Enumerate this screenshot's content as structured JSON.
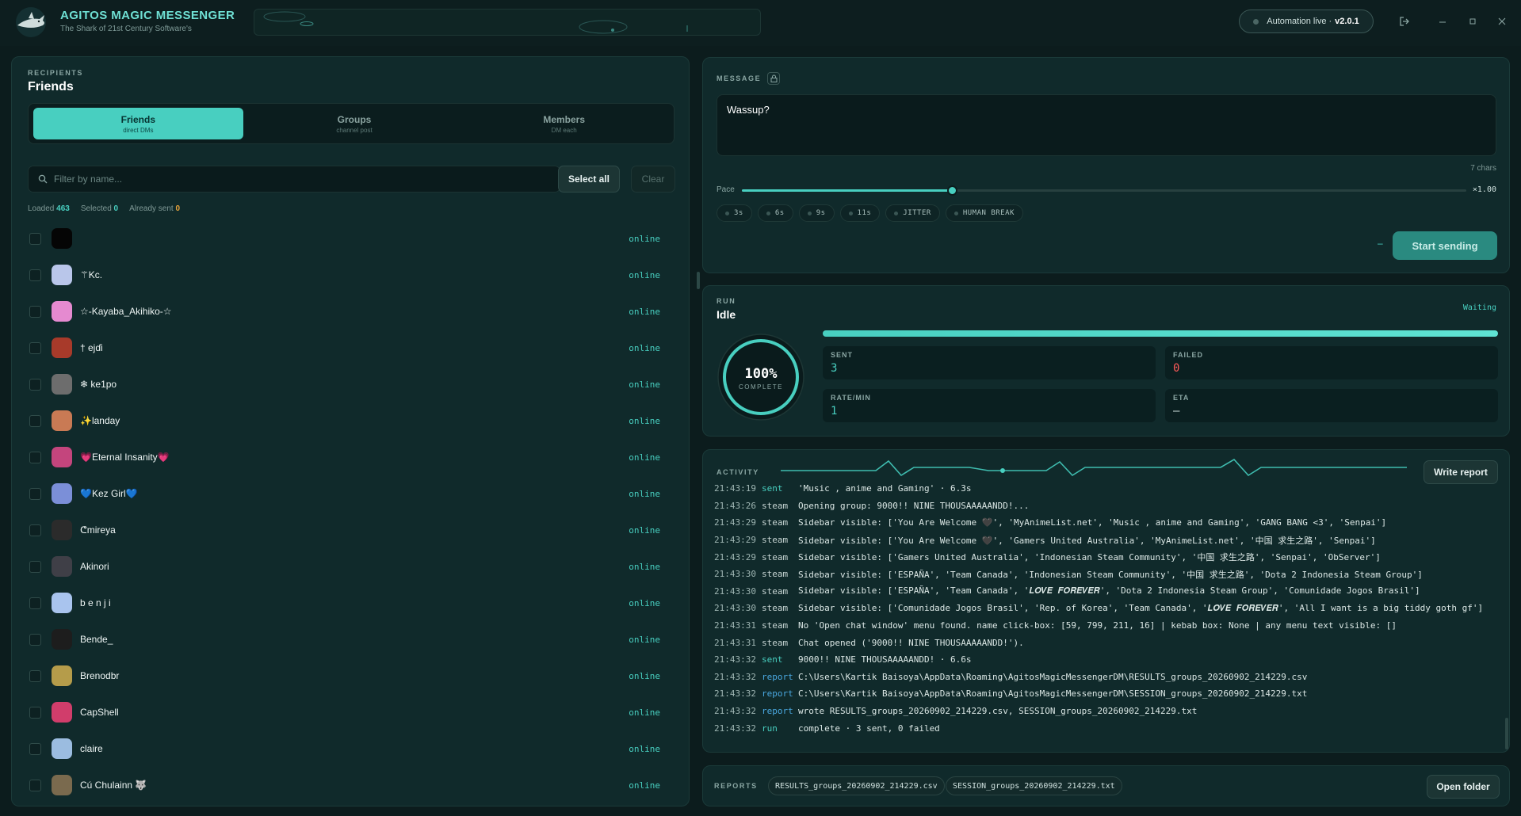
{
  "app": {
    "title": "AGITOS MAGIC MESSENGER",
    "subtitle": "The Shark of 21st Century Software's",
    "automation_label": "Automation live ·",
    "version": "v2.0.1"
  },
  "recipients": {
    "section_label": "RECIPIENTS",
    "title": "Friends",
    "tabs": [
      {
        "label": "Friends",
        "sub": "direct DMs",
        "active": true
      },
      {
        "label": "Groups",
        "sub": "channel post",
        "active": false
      },
      {
        "label": "Members",
        "sub": "DM each",
        "active": false
      }
    ],
    "search_placeholder": "Filter by name...",
    "select_all_label": "Select all",
    "clear_label": "Clear",
    "stats": {
      "loaded_label": "Loaded",
      "loaded": "463",
      "selected_label": "Selected",
      "selected": "0",
      "already_label": "Already sent",
      "already": "0"
    },
    "items": [
      {
        "name": "",
        "status": "online",
        "avatar_color": "#050505"
      },
      {
        "name": "⚚Kc.",
        "status": "online",
        "avatar_color": "#b9c6ea"
      },
      {
        "name": "☆-Kayaba_Akihiko-☆",
        "status": "online",
        "avatar_color": "#e58ad0"
      },
      {
        "name": "† ejɗi",
        "status": "online",
        "avatar_color": "#a83a2a"
      },
      {
        "name": "❄ ke1po",
        "status": "online",
        "avatar_color": "#6d6d6d"
      },
      {
        "name": "✨landay",
        "status": "online",
        "avatar_color": "#c97a54"
      },
      {
        "name": "💗Eternal Insanity💗",
        "status": "online",
        "avatar_color": "#c4457d"
      },
      {
        "name": "💙Kez Girl💙",
        "status": "online",
        "avatar_color": "#7b8fd8"
      },
      {
        "name": "ᕦmireya",
        "status": "online",
        "avatar_color": "#2b2b2b"
      },
      {
        "name": "Akinori",
        "status": "online",
        "avatar_color": "#3f3f47"
      },
      {
        "name": "b e n j i",
        "status": "online",
        "avatar_color": "#a9c4ee"
      },
      {
        "name": "Bende_",
        "status": "online",
        "avatar_color": "#1d1d1d"
      },
      {
        "name": "Brenodbr",
        "status": "online",
        "avatar_color": "#b59c4a"
      },
      {
        "name": "CapShell",
        "status": "online",
        "avatar_color": "#d13d6b"
      },
      {
        "name": "claire",
        "status": "online",
        "avatar_color": "#9bbce0"
      },
      {
        "name": "Cú Chulainn 🐺",
        "status": "online",
        "avatar_color": "#7a6a4e"
      }
    ]
  },
  "message": {
    "section_label": "MESSAGE",
    "text": "Wassup?",
    "char_count": "7 chars",
    "pace_label": "Pace",
    "pace_value": "×1.00",
    "pace_level": 0.29,
    "chips": [
      "3s",
      "6s",
      "9s",
      "11s",
      "JITTER",
      "HUMAN BREAK"
    ],
    "dash": "–",
    "start_label": "Start sending"
  },
  "run": {
    "section_label": "RUN",
    "title": "Idle",
    "status": "Waiting",
    "progress": 1.0,
    "ring_pct": "100%",
    "ring_sub": "COMPLETE",
    "stats": {
      "sent_label": "SENT",
      "sent": "3",
      "failed_label": "FAILED",
      "failed": "0",
      "rate_label": "RATE/MIN",
      "rate": "1",
      "eta_label": "ETA",
      "eta": "—"
    }
  },
  "activity": {
    "section_label": "ACTIVITY",
    "report_label": "Write report",
    "colors": {
      "sent": "#48cfc0",
      "steam": "#c8d6d4",
      "report": "#4aa8e0",
      "run": "#48cfc0"
    },
    "logs": [
      {
        "ts": "21:43:19",
        "cat": "sent",
        "msg": "'Music , anime and Gaming' · 6.3s"
      },
      {
        "ts": "21:43:26",
        "cat": "steam",
        "msg": "Opening group: 9000!! NINE THOUSAAAAANDD!..."
      },
      {
        "ts": "21:43:29",
        "cat": "steam",
        "msg": "Sidebar visible: ['You Are Welcome 🖤', 'MyAnimeList.net', 'Music , anime and Gaming', 'GANG BANG <3', 'Senpai']"
      },
      {
        "ts": "21:43:29",
        "cat": "steam",
        "msg": "Sidebar visible: ['You Are Welcome 🖤', 'Gamers United Australia', 'MyAnimeList.net', '中国 求生之路', 'Senpai']"
      },
      {
        "ts": "21:43:29",
        "cat": "steam",
        "msg": "Sidebar visible: ['Gamers United Australia', 'Indonesian Steam Community', '中国 求生之路', 'Senpai', 'ObServer']"
      },
      {
        "ts": "21:43:30",
        "cat": "steam",
        "msg": "Sidebar visible: ['ESPAÑA', 'Team Canada', 'Indonesian Steam Community', '中国 求生之路', 'Dota 2 Indonesia Steam Group']"
      },
      {
        "ts": "21:43:30",
        "cat": "steam",
        "msg": "Sidebar visible: ['ESPAÑA', 'Team Canada', '𝑳𝑶𝑽𝑬 𝑭𝑶𝑹𝑬𝑽𝑬𝑹', 'Dota 2 Indonesia Steam Group', 'Comunidade Jogos Brasil']"
      },
      {
        "ts": "21:43:30",
        "cat": "steam",
        "msg": "Sidebar visible: ['Comunidade Jogos Brasil', 'Rep. of Korea', 'Team Canada', '𝑳𝑶𝑽𝑬 𝑭𝑶𝑹𝑬𝑽𝑬𝑹', 'All I want is a big tiddy goth gf']"
      },
      {
        "ts": "21:43:31",
        "cat": "steam",
        "msg": "No 'Open chat window' menu found. name click-box: [59, 799, 211, 16] | kebab box: None | any menu text visible: []"
      },
      {
        "ts": "21:43:31",
        "cat": "steam",
        "msg": "Chat opened ('9000!! NINE THOUSAAAAANDD!')."
      },
      {
        "ts": "21:43:32",
        "cat": "sent",
        "msg": "9000!! NINE THOUSAAAAANDD! · 6.6s"
      },
      {
        "ts": "21:43:32",
        "cat": "report",
        "msg": "C:\\Users\\Kartik Baisoya\\AppData\\Roaming\\AgitosMagicMessengerDM\\RESULTS_groups_20260902_214229.csv"
      },
      {
        "ts": "21:43:32",
        "cat": "report",
        "msg": "C:\\Users\\Kartik Baisoya\\AppData\\Roaming\\AgitosMagicMessengerDM\\SESSION_groups_20260902_214229.txt"
      },
      {
        "ts": "21:43:32",
        "cat": "report",
        "msg": "wrote RESULTS_groups_20260902_214229.csv, SESSION_groups_20260902_214229.txt"
      },
      {
        "ts": "21:43:32",
        "cat": "run",
        "msg": "complete · 3 sent, 0 failed"
      }
    ]
  },
  "reports": {
    "section_label": "REPORTS",
    "files": [
      "RESULTS_groups_20260902_214229.csv",
      "SESSION_groups_20260902_214229.txt"
    ],
    "open_label": "Open folder"
  },
  "colors": {
    "accent": "#48cfc0",
    "failed": "#ff5a5a",
    "warn": "#e7a33a"
  }
}
